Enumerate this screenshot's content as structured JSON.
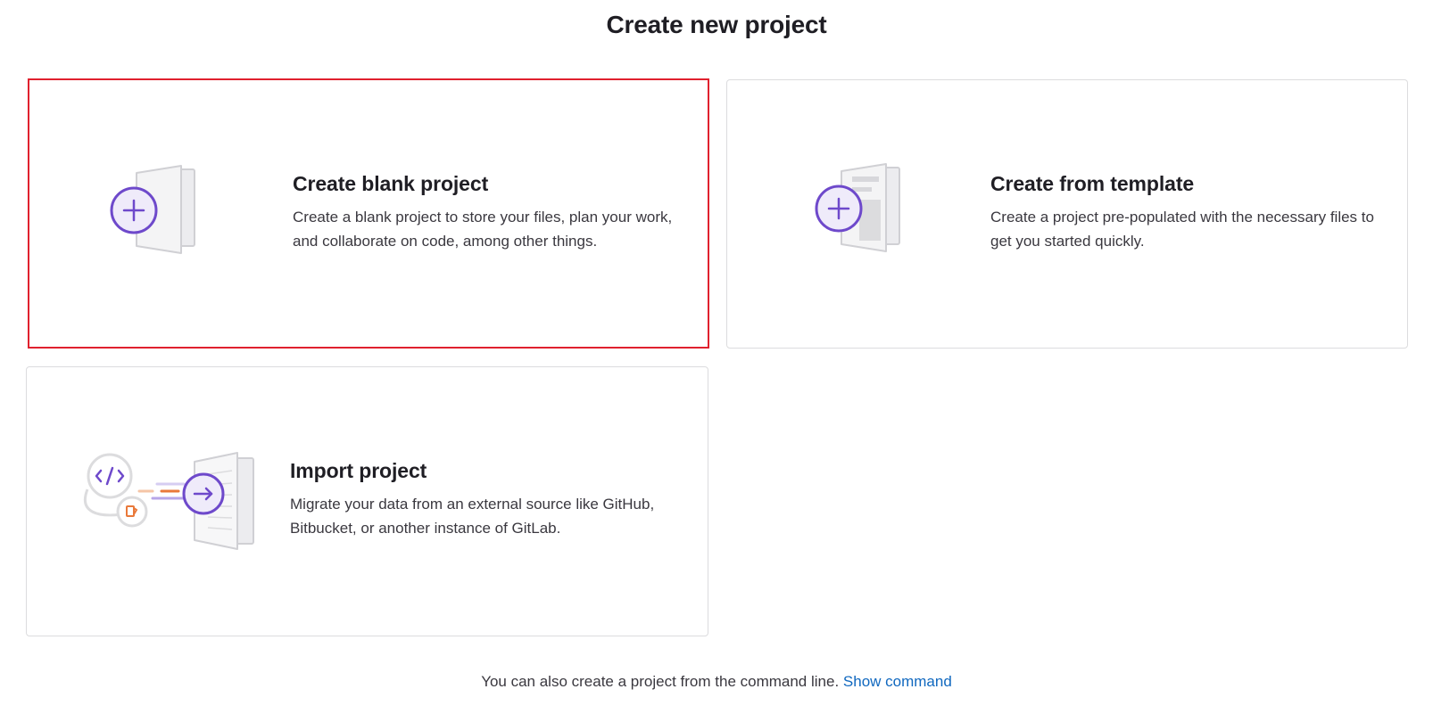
{
  "header": {
    "title": "Create new project"
  },
  "cards": [
    {
      "title": "Create blank project",
      "description": "Create a blank project to store your files, plan your work, and collaborate on code, among other things.",
      "icon": "blank-project-illustration",
      "selected": true
    },
    {
      "title": "Create from template",
      "description": "Create a project pre-populated with the necessary files to get you started quickly.",
      "icon": "template-project-illustration",
      "selected": false
    },
    {
      "title": "Import project",
      "description": "Migrate your data from an external source like GitHub, Bitbucket, or another instance of GitLab.",
      "icon": "import-project-illustration",
      "selected": false
    }
  ],
  "footer": {
    "text": "You can also create a project from the command line.",
    "link_label": "Show command"
  },
  "colors": {
    "accent_purple": "#6e49cb",
    "selection_border": "#e0212e",
    "link_blue": "#1068bf",
    "card_border": "#dcdcde",
    "orange": "#e9793a"
  }
}
